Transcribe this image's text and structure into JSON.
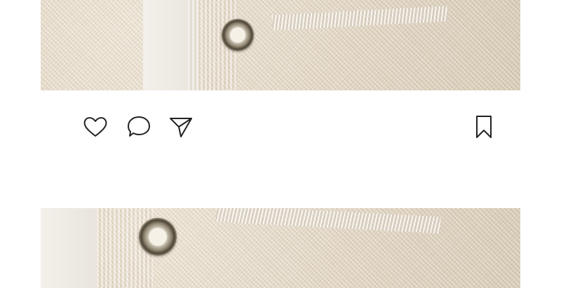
{
  "post": {
    "photo_top": "tweed-jacket-photo-top",
    "photo_bottom": "tweed-jacket-photo-bottom"
  },
  "actions": {
    "like_icon": "heart-icon",
    "comment_icon": "comment-bubble-icon",
    "share_icon": "paper-plane-icon",
    "save_icon": "bookmark-icon"
  },
  "colors": {
    "icon_stroke": "#222222",
    "background": "#ffffff",
    "fabric": "#e6dccb"
  }
}
